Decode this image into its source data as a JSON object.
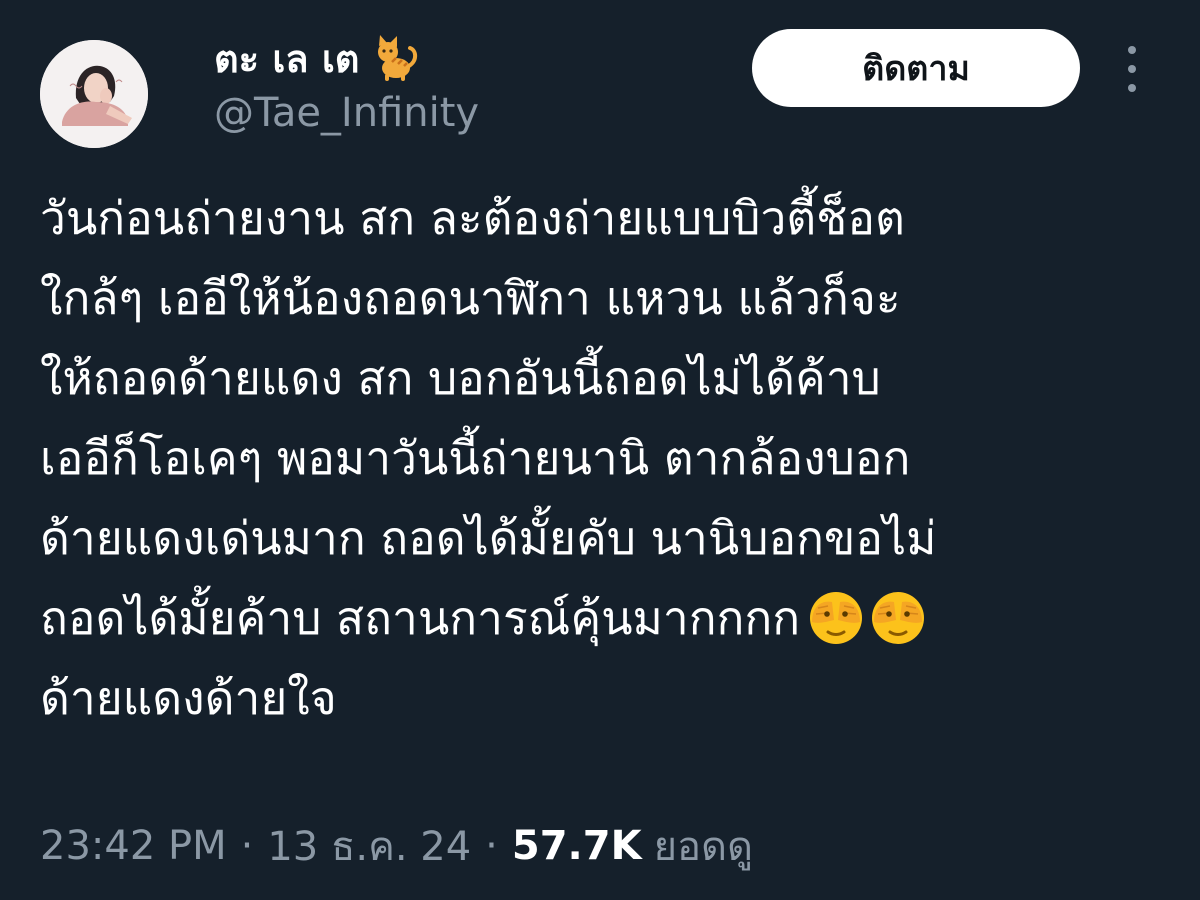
{
  "author": {
    "display_name": "ตะ เล เต",
    "name_emoji": "cat-icon",
    "handle": "@Tae_Infinity"
  },
  "follow_button": {
    "label": "ติดตาม"
  },
  "more_menu": {
    "icon": "more-vertical-icon"
  },
  "tweet": {
    "lines": [
      "วันก่อนถ่ายงาน สก ละต้องถ่ายแบบบิวตี้ช็อต",
      "ใกล้ๆ เออีให้น้องถอดนาฬิกา แหวน แล้วก็จะ",
      "ให้ถอดด้ายแดง สก บอกอันนี้ถอดไม่ได้ค้าบ",
      "เออีก็โอเคๆ พอมาวันนี้ถ่ายนานิ ตากล้องบอก",
      "ด้ายแดงเด่นมาก ถอดได้มั้ยคับ นานิบอกขอไม่",
      "ถอดได้มั้ยค้าบ สถานการณ์คุ้นมากกกก",
      "ด้ายแดงด้ายใจ"
    ],
    "emoji": "face-with-hands-over-eyes-icon"
  },
  "meta": {
    "time": "23:42 PM",
    "separator": "·",
    "date": "13 ธ.ค. 24",
    "views_count": "57.7K",
    "views_label": "ยอดดู"
  },
  "colors": {
    "background": "#15202b",
    "primary_text": "#ffffff",
    "secondary_text": "#8b98a5",
    "button_bg": "#ffffff",
    "button_text": "#0f1419"
  }
}
